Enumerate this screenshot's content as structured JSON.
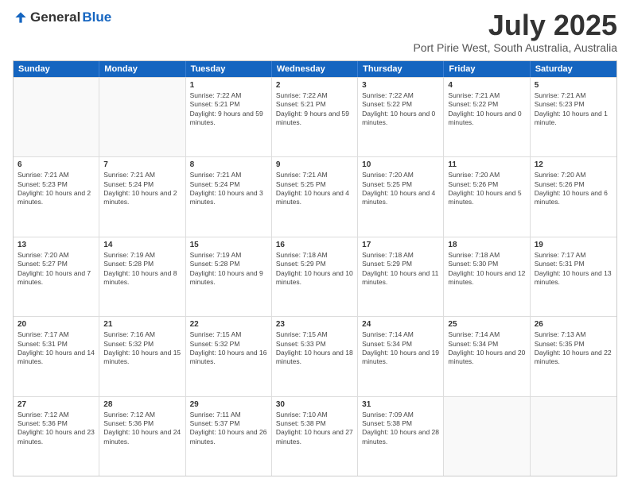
{
  "logo": {
    "general": "General",
    "blue": "Blue"
  },
  "title": "July 2025",
  "location": "Port Pirie West, South Australia, Australia",
  "header_days": [
    "Sunday",
    "Monday",
    "Tuesday",
    "Wednesday",
    "Thursday",
    "Friday",
    "Saturday"
  ],
  "rows": [
    [
      {
        "day": "",
        "text": "",
        "empty": true
      },
      {
        "day": "",
        "text": "",
        "empty": true
      },
      {
        "day": "1",
        "text": "Sunrise: 7:22 AM\nSunset: 5:21 PM\nDaylight: 9 hours and 59 minutes."
      },
      {
        "day": "2",
        "text": "Sunrise: 7:22 AM\nSunset: 5:21 PM\nDaylight: 9 hours and 59 minutes."
      },
      {
        "day": "3",
        "text": "Sunrise: 7:22 AM\nSunset: 5:22 PM\nDaylight: 10 hours and 0 minutes."
      },
      {
        "day": "4",
        "text": "Sunrise: 7:21 AM\nSunset: 5:22 PM\nDaylight: 10 hours and 0 minutes."
      },
      {
        "day": "5",
        "text": "Sunrise: 7:21 AM\nSunset: 5:23 PM\nDaylight: 10 hours and 1 minute."
      }
    ],
    [
      {
        "day": "6",
        "text": "Sunrise: 7:21 AM\nSunset: 5:23 PM\nDaylight: 10 hours and 2 minutes."
      },
      {
        "day": "7",
        "text": "Sunrise: 7:21 AM\nSunset: 5:24 PM\nDaylight: 10 hours and 2 minutes."
      },
      {
        "day": "8",
        "text": "Sunrise: 7:21 AM\nSunset: 5:24 PM\nDaylight: 10 hours and 3 minutes."
      },
      {
        "day": "9",
        "text": "Sunrise: 7:21 AM\nSunset: 5:25 PM\nDaylight: 10 hours and 4 minutes."
      },
      {
        "day": "10",
        "text": "Sunrise: 7:20 AM\nSunset: 5:25 PM\nDaylight: 10 hours and 4 minutes."
      },
      {
        "day": "11",
        "text": "Sunrise: 7:20 AM\nSunset: 5:26 PM\nDaylight: 10 hours and 5 minutes."
      },
      {
        "day": "12",
        "text": "Sunrise: 7:20 AM\nSunset: 5:26 PM\nDaylight: 10 hours and 6 minutes."
      }
    ],
    [
      {
        "day": "13",
        "text": "Sunrise: 7:20 AM\nSunset: 5:27 PM\nDaylight: 10 hours and 7 minutes."
      },
      {
        "day": "14",
        "text": "Sunrise: 7:19 AM\nSunset: 5:28 PM\nDaylight: 10 hours and 8 minutes."
      },
      {
        "day": "15",
        "text": "Sunrise: 7:19 AM\nSunset: 5:28 PM\nDaylight: 10 hours and 9 minutes."
      },
      {
        "day": "16",
        "text": "Sunrise: 7:18 AM\nSunset: 5:29 PM\nDaylight: 10 hours and 10 minutes."
      },
      {
        "day": "17",
        "text": "Sunrise: 7:18 AM\nSunset: 5:29 PM\nDaylight: 10 hours and 11 minutes."
      },
      {
        "day": "18",
        "text": "Sunrise: 7:18 AM\nSunset: 5:30 PM\nDaylight: 10 hours and 12 minutes."
      },
      {
        "day": "19",
        "text": "Sunrise: 7:17 AM\nSunset: 5:31 PM\nDaylight: 10 hours and 13 minutes."
      }
    ],
    [
      {
        "day": "20",
        "text": "Sunrise: 7:17 AM\nSunset: 5:31 PM\nDaylight: 10 hours and 14 minutes."
      },
      {
        "day": "21",
        "text": "Sunrise: 7:16 AM\nSunset: 5:32 PM\nDaylight: 10 hours and 15 minutes."
      },
      {
        "day": "22",
        "text": "Sunrise: 7:15 AM\nSunset: 5:32 PM\nDaylight: 10 hours and 16 minutes."
      },
      {
        "day": "23",
        "text": "Sunrise: 7:15 AM\nSunset: 5:33 PM\nDaylight: 10 hours and 18 minutes."
      },
      {
        "day": "24",
        "text": "Sunrise: 7:14 AM\nSunset: 5:34 PM\nDaylight: 10 hours and 19 minutes."
      },
      {
        "day": "25",
        "text": "Sunrise: 7:14 AM\nSunset: 5:34 PM\nDaylight: 10 hours and 20 minutes."
      },
      {
        "day": "26",
        "text": "Sunrise: 7:13 AM\nSunset: 5:35 PM\nDaylight: 10 hours and 22 minutes."
      }
    ],
    [
      {
        "day": "27",
        "text": "Sunrise: 7:12 AM\nSunset: 5:36 PM\nDaylight: 10 hours and 23 minutes."
      },
      {
        "day": "28",
        "text": "Sunrise: 7:12 AM\nSunset: 5:36 PM\nDaylight: 10 hours and 24 minutes."
      },
      {
        "day": "29",
        "text": "Sunrise: 7:11 AM\nSunset: 5:37 PM\nDaylight: 10 hours and 26 minutes."
      },
      {
        "day": "30",
        "text": "Sunrise: 7:10 AM\nSunset: 5:38 PM\nDaylight: 10 hours and 27 minutes."
      },
      {
        "day": "31",
        "text": "Sunrise: 7:09 AM\nSunset: 5:38 PM\nDaylight: 10 hours and 28 minutes."
      },
      {
        "day": "",
        "text": "",
        "empty": true
      },
      {
        "day": "",
        "text": "",
        "empty": true
      }
    ]
  ]
}
